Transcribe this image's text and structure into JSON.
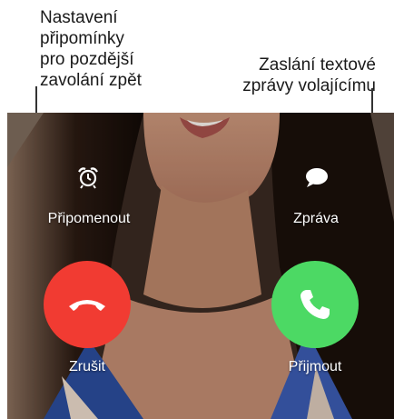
{
  "callouts": {
    "left": [
      "Nastavení",
      "připomínky",
      "pro pozdější",
      "zavolání zpět"
    ],
    "right": [
      "Zaslání textové",
      "zprávy volajícímu"
    ]
  },
  "actions": {
    "remind_label": "Připomenout",
    "message_label": "Zpráva",
    "decline_label": "Zrušit",
    "accept_label": "Přijmout"
  },
  "colors": {
    "decline": "#f13b32",
    "accept": "#4cd964"
  },
  "icons": {
    "remind": "alarm-clock-icon",
    "message": "speech-bubble-icon",
    "decline": "phone-hangup-icon",
    "accept": "phone-icon"
  }
}
